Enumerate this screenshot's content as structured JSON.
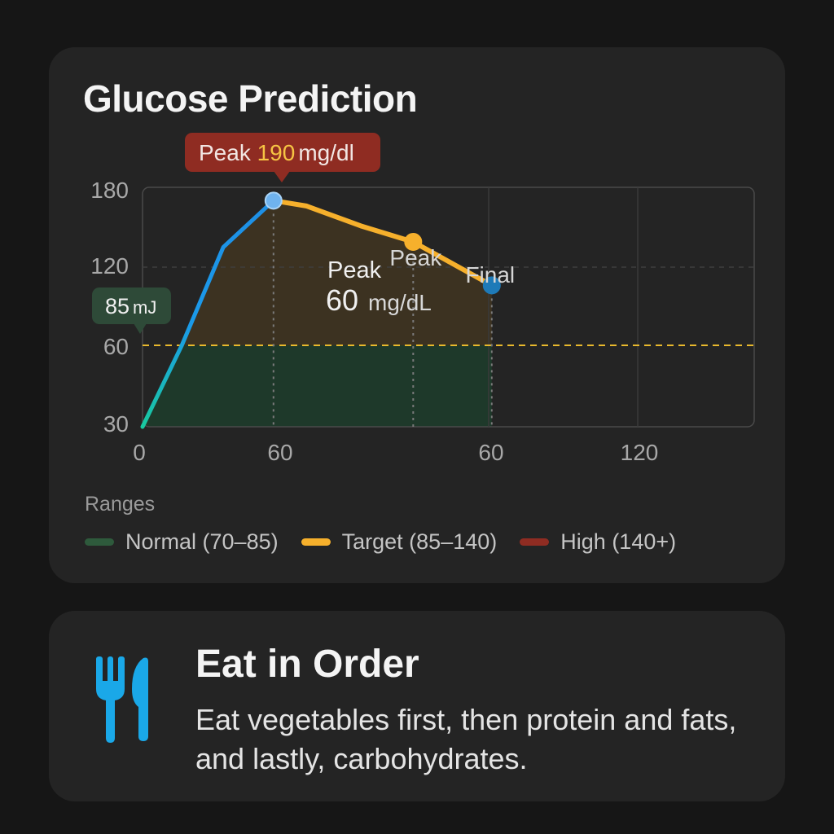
{
  "title": "Glucose Prediction",
  "chart_data": {
    "type": "line",
    "title": "Glucose Prediction",
    "x_tick_labels": [
      "0",
      "60",
      "60",
      "120"
    ],
    "y_tick_labels": [
      "180",
      "120",
      "60",
      "30"
    ],
    "xlabel": "",
    "ylabel": "",
    "series": [
      {
        "points": [
          [
            0,
            30
          ],
          [
            18,
            60
          ],
          [
            37,
            135
          ],
          [
            60,
            170
          ],
          [
            75,
            166
          ],
          [
            100,
            151
          ],
          [
            124,
            139
          ],
          [
            160,
            106
          ]
        ]
      }
    ],
    "threshold_line": 60,
    "markers": [
      {
        "x": 60,
        "y": 170,
        "label": ""
      },
      {
        "x": 124,
        "y": 139,
        "label": "Peak"
      },
      {
        "x": 160,
        "y": 106,
        "label": "Final"
      }
    ],
    "colors": {
      "rising_line": "#1e8fe6",
      "line": "#f6b02c",
      "normal_fill": "#1f3b2b",
      "target_fill": "#3e3422",
      "threshold": "#e9b92d",
      "grid": "#4a4a4a"
    },
    "grid": true
  },
  "callouts": {
    "top": {
      "prefix": "Peak",
      "value": "190",
      "unit": "mg/dl"
    },
    "left": {
      "value": "85",
      "unit": "mJ"
    },
    "inner": {
      "label": "Peak",
      "value": "60",
      "unit": "mg/dL"
    }
  },
  "ranges": {
    "label": "Ranges",
    "items": [
      {
        "name": "Normal",
        "range": "(70–85)",
        "color": "#2e5a3c"
      },
      {
        "name": "Target",
        "range": "(85–140)",
        "color": "#f6b02c"
      },
      {
        "name": "High",
        "range": "(140+)",
        "color": "#8f2c22"
      }
    ]
  },
  "tip": {
    "icon": "fork-knife-icon",
    "icon_color": "#1aa8e8",
    "title": "Eat in Order",
    "body": "Eat vegetables first, then protein and fats, and lastly, carbohydrates."
  }
}
